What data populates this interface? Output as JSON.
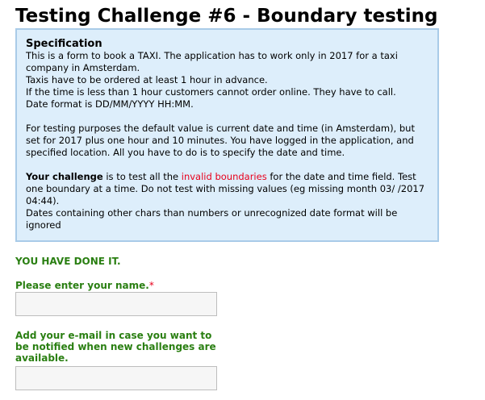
{
  "page": {
    "title": "Testing Challenge #6 - Boundary testing"
  },
  "specification": {
    "heading": "Specification",
    "line1": "This is a form to book a TAXI. The application has to work only in 2017 for a taxi company in Amsterdam.",
    "line2": "Taxis have to be ordered at least 1 hour in advance.",
    "line3": "If the time is less than 1 hour customers cannot order online. They have to call.",
    "line4": "Date format is DD/MM/YYYY HH:MM.",
    "para2": "For testing purposes the default value is current date and time (in Amsterdam), but set for 2017 plus one hour and 10 minutes. You have logged in the application, and specified location. All you have to do is to specify the date and time.",
    "challenge_label": "Your challenge",
    "challenge_pre": " is to test all the ",
    "challenge_highlight": "invalid boundaries",
    "challenge_post": " for the date and time field. Test one boundary at a time. Do not test with missing values (eg missing month 03/ /2017 04:44).",
    "line_last": "Dates containing other chars than numbers or unrecognized date format will be ignored"
  },
  "status": {
    "message": "YOU HAVE DONE IT."
  },
  "form": {
    "name_label": "Please enter your name.",
    "required_marker": "*",
    "name_value": "",
    "email_label": "Add your e-mail in case you want to be notified when new challenges are available.",
    "email_value": ""
  },
  "colors": {
    "accent_green": "#2a7f12",
    "highlight_red": "#e8001c",
    "spec_background": "#ddeefb",
    "spec_border": "#a9cbe8"
  }
}
